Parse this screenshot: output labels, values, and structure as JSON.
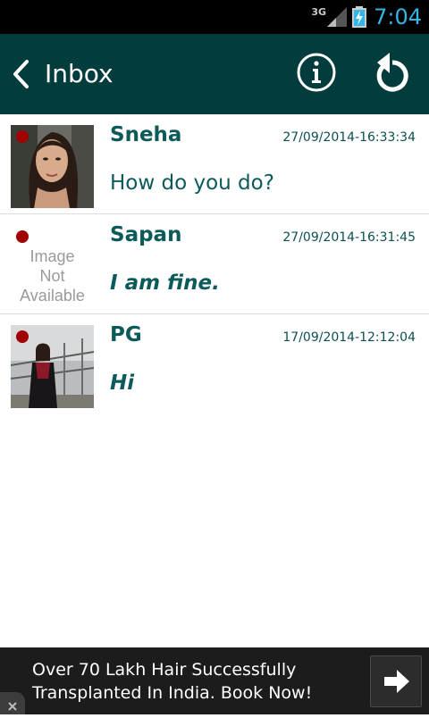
{
  "status_bar": {
    "network": "3G",
    "time": "7:04"
  },
  "header": {
    "title": "Inbox"
  },
  "messages": [
    {
      "name": "Sneha",
      "timestamp": "27/09/2014-16:33:34",
      "text": "How do you do?",
      "unread": true,
      "avatar": "photo"
    },
    {
      "name": "Sapan",
      "timestamp": "27/09/2014-16:31:45",
      "text": "I am fine.",
      "unread": true,
      "avatar": "Image Not Available",
      "avatar_lines": [
        "Image",
        "Not",
        "Available"
      ]
    },
    {
      "name": "PG",
      "timestamp": "17/09/2014-12:12:04",
      "text": "Hi",
      "unread": true,
      "avatar": "photo"
    }
  ],
  "ad": {
    "line1": "Over 70 Lakh Hair Successfully",
    "line2": "Transplanted In India. Book Now!"
  },
  "colors": {
    "appbar": "#023c3c",
    "accent_text": "#0c5a5a",
    "unread_dot": "#a00000",
    "clock": "#33b5e5"
  }
}
